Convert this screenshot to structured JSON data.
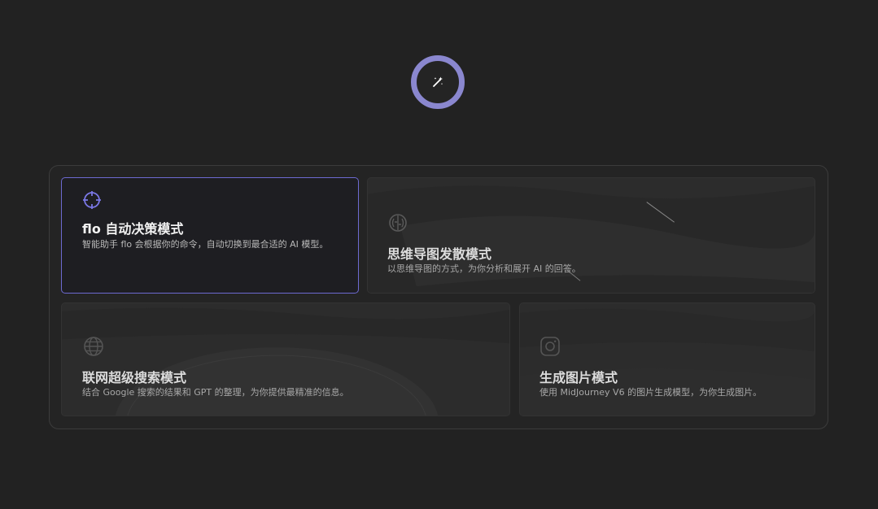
{
  "logo": {
    "icon": "magic-wand-icon",
    "ring_color": "#8a87cf"
  },
  "modes": [
    {
      "title": "flo 自动决策模式",
      "description": "智能助手 flo 会根据你的命令，自动切换到最合适的 AI 模型。",
      "icon": "target-icon",
      "icon_color": "#7b78e6",
      "active": true
    },
    {
      "title": "思维导图发散模式",
      "description": "以思维导图的方式，为你分析和展开 AI 的回答。",
      "icon": "brain-icon",
      "active": false
    },
    {
      "title": "联网超级搜索模式",
      "description": "结合 Google 搜索的结果和 GPT 的整理，为你提供最精准的信息。",
      "icon": "globe-icon",
      "active": false
    },
    {
      "title": "生成图片模式",
      "description": "使用 MidJourney V6 的图片生成模型，为你生成图片。",
      "icon": "instagram-icon",
      "active": false
    }
  ],
  "colors": {
    "background": "#222222",
    "accent": "#6d6ad1",
    "card": "#2c2c2c"
  }
}
